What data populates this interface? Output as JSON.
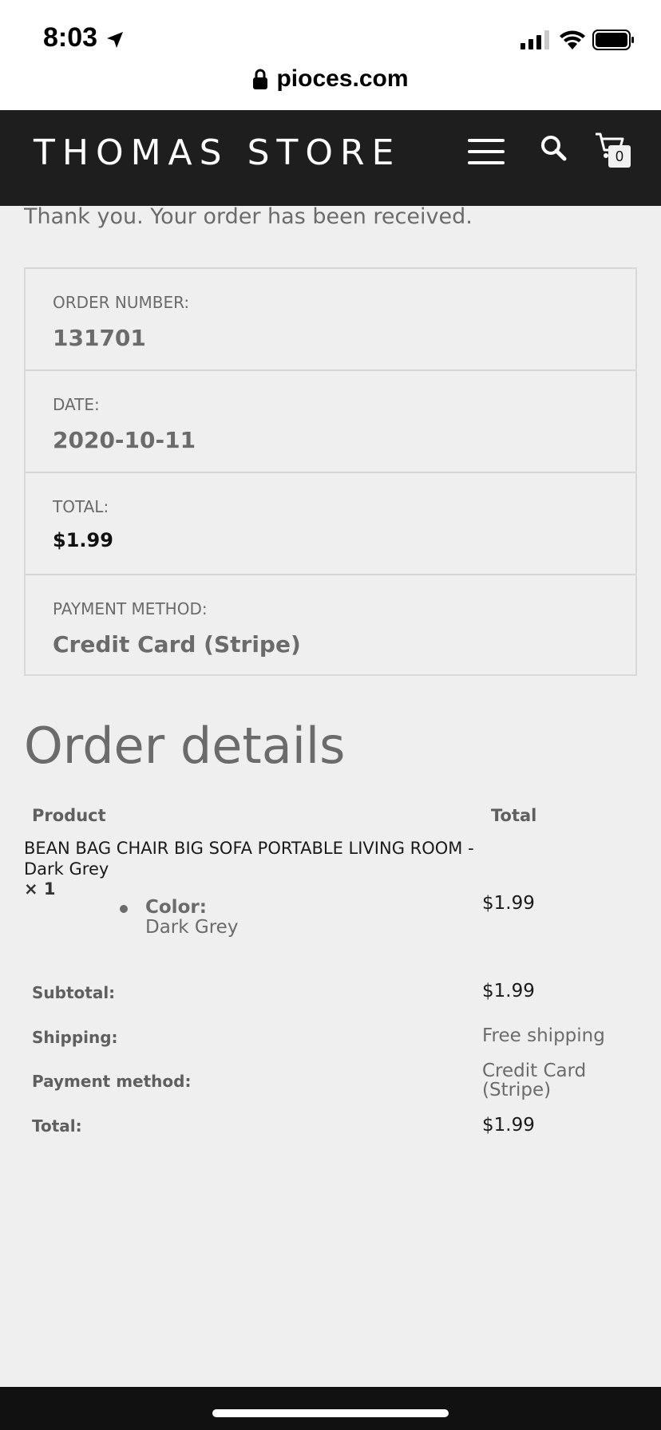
{
  "status_bar": {
    "time": "8:03",
    "icons": [
      "location-arrow-icon",
      "signal-icon",
      "wifi-icon",
      "battery-icon"
    ]
  },
  "browser": {
    "url": "pioces.com",
    "lock_icon": "lock-icon"
  },
  "header": {
    "brand": "THOMAS STORE",
    "cart_count": "0",
    "icons": [
      "hamburger-menu-icon",
      "search-icon",
      "cart-icon"
    ]
  },
  "thank_you": "Thank you. Your order has been received.",
  "overview": {
    "order_number_label": "ORDER NUMBER:",
    "order_number": "131701",
    "date_label": "DATE:",
    "date": "2020-10-11",
    "total_label": "TOTAL:",
    "total": "$1.99",
    "payment_label": "PAYMENT METHOD:",
    "payment": "Credit Card (Stripe)"
  },
  "details": {
    "title": "Order details",
    "col_product": "Product",
    "col_total": "Total",
    "item": {
      "name": "BEAN BAG CHAIR BIG SOFA PORTABLE LIVING ROOM - Dark Grey",
      "qty": "× 1",
      "meta_key": "Color:",
      "meta_value": "Dark Grey",
      "price": "$1.99"
    },
    "totals": {
      "subtotal_label": "Subtotal:",
      "subtotal": "$1.99",
      "shipping_label": "Shipping:",
      "shipping": "Free shipping",
      "payment_label": "Payment method:",
      "payment_line1": "Credit Card",
      "payment_line2": "(Stripe)",
      "total_label": "Total:",
      "total": "$1.99"
    }
  }
}
